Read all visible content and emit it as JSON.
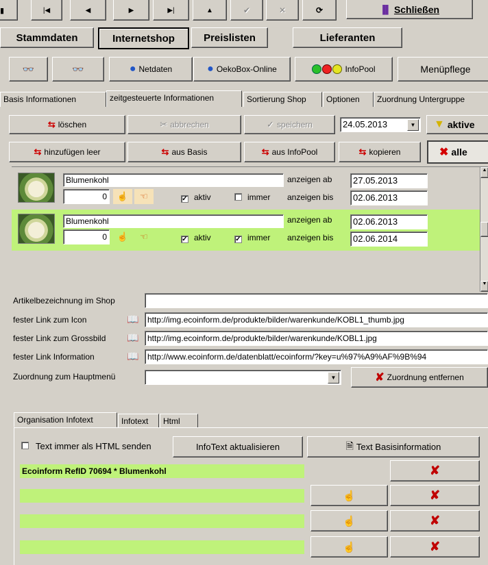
{
  "nav": {
    "buttons": [
      "|◀",
      "◀",
      "▶",
      "▶|",
      "▲",
      "✔",
      "✕",
      "⟳"
    ],
    "close_label": "Schließen"
  },
  "main_tabs": [
    "Stammdaten",
    "Internetshop",
    "Preislisten",
    "Lieferanten"
  ],
  "toolbar": {
    "netdaten": "Netdaten",
    "oekobox": "OekoBox-Online",
    "infopool": "InfoPool",
    "menuepflege": "Menüpflege"
  },
  "sub_tabs": [
    "Basis Informationen",
    "zeitgesteuerte Informationen",
    "Sortierung Shop",
    "Optionen",
    "Zuordnung Untergruppe"
  ],
  "actions": {
    "loeschen": "löschen",
    "abbrechen": "abbrechen",
    "speichern": "speichern",
    "date": "24.05.2013",
    "aktive": "aktive",
    "hinzufuegen_leer": "hinzufügen leer",
    "aus_basis": "aus Basis",
    "aus_infopool": "aus InfoPool",
    "kopieren": "kopieren",
    "alle": "alle"
  },
  "entries": [
    {
      "name": "Blumenkohl",
      "qty": "0",
      "aktiv_label": "aktiv",
      "aktiv": true,
      "immer_label": "immer",
      "immer": false,
      "ab_label": "anzeigen ab",
      "ab": "27.05.2013",
      "bis_label": "anzeigen bis",
      "bis": "02.06.2013"
    },
    {
      "name": "Blumenkohl",
      "qty": "0",
      "aktiv_label": "aktiv",
      "aktiv": true,
      "immer_label": "immer",
      "immer": true,
      "ab_label": "anzeigen ab",
      "ab": "02.06.2013",
      "bis_label": "anzeigen bis",
      "bis": "02.06.2014"
    }
  ],
  "form": {
    "artikel_label": "Artikelbezeichnung im Shop",
    "artikel_value": "",
    "icon_label": "fester Link zum Icon",
    "icon_value": "http://img.ecoinform.de/produkte/bilder/warenkunde/KOBL1_thumb.jpg",
    "gross_label": "fester Link zum Grossbild",
    "gross_value": "http://img.ecoinform.de/produkte/bilder/warenkunde/KOBL1.jpg",
    "info_label": "fester Link Information",
    "info_value": "http://www.ecoinform.de/datenblatt/ecoinform/?key=u%97%A9%AF%9B%94",
    "haupt_label": "Zuordnung zum Hauptmenü",
    "haupt_value": "",
    "entfernen": "Zuordnung entfernen"
  },
  "bottom_tabs": [
    "Organisation Infotext",
    "Infotext",
    "Html"
  ],
  "infotext": {
    "html_label": "Text immer als HTML senden",
    "aktualisieren": "InfoText aktualisieren",
    "basis": "Text Basisinformation",
    "rows": [
      "Ecoinform RefID 70694 * Blumenkohl",
      "",
      "",
      ""
    ]
  }
}
